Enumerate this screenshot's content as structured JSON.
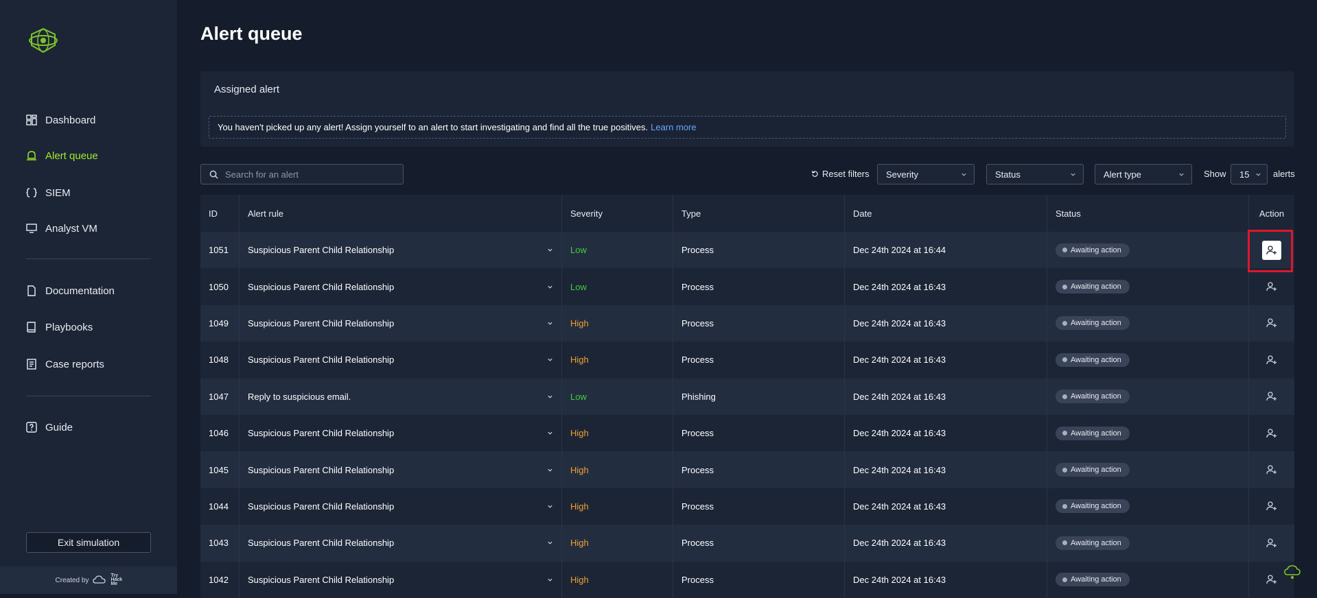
{
  "sidebar": {
    "nav_top": [
      {
        "label": "Dashboard",
        "icon": "dashboard-icon"
      },
      {
        "label": "Alert queue",
        "icon": "bell-icon",
        "active": true
      },
      {
        "label": "SIEM",
        "icon": "brackets-icon"
      },
      {
        "label": "Analyst VM",
        "icon": "monitor-icon"
      }
    ],
    "nav_mid": [
      {
        "label": "Documentation",
        "icon": "document-icon"
      },
      {
        "label": "Playbooks",
        "icon": "book-icon"
      },
      {
        "label": "Case reports",
        "icon": "report-icon"
      }
    ],
    "nav_bottom": [
      {
        "label": "Guide",
        "icon": "help-icon"
      }
    ],
    "exit_label": "Exit simulation",
    "created_by": "Created by",
    "brand_text": "Try Hack Me"
  },
  "page": {
    "title": "Alert queue",
    "assigned_title": "Assigned alert",
    "notice_text": "You haven't picked up any alert! Assign yourself to an alert to start investigating and find all the true positives.",
    "notice_link": "Learn more"
  },
  "filters": {
    "search_placeholder": "Search for an alert",
    "reset_label": "Reset filters",
    "severity_label": "Severity",
    "status_label": "Status",
    "alert_type_label": "Alert type",
    "show_label": "Show",
    "show_value": "15",
    "alerts_label": "alerts"
  },
  "table": {
    "headers": {
      "id": "ID",
      "rule": "Alert rule",
      "severity": "Severity",
      "type": "Type",
      "date": "Date",
      "status": "Status",
      "action": "Action"
    },
    "rows": [
      {
        "id": "1051",
        "rule": "Suspicious Parent Child Relationship",
        "severity": "Low",
        "type": "Process",
        "date": "Dec 24th 2024 at 16:44",
        "status": "Awaiting action"
      },
      {
        "id": "1050",
        "rule": "Suspicious Parent Child Relationship",
        "severity": "Low",
        "type": "Process",
        "date": "Dec 24th 2024 at 16:43",
        "status": "Awaiting action"
      },
      {
        "id": "1049",
        "rule": "Suspicious Parent Child Relationship",
        "severity": "High",
        "type": "Process",
        "date": "Dec 24th 2024 at 16:43",
        "status": "Awaiting action"
      },
      {
        "id": "1048",
        "rule": "Suspicious Parent Child Relationship",
        "severity": "High",
        "type": "Process",
        "date": "Dec 24th 2024 at 16:43",
        "status": "Awaiting action"
      },
      {
        "id": "1047",
        "rule": "Reply to suspicious email.",
        "severity": "Low",
        "type": "Phishing",
        "date": "Dec 24th 2024 at 16:43",
        "status": "Awaiting action"
      },
      {
        "id": "1046",
        "rule": "Suspicious Parent Child Relationship",
        "severity": "High",
        "type": "Process",
        "date": "Dec 24th 2024 at 16:43",
        "status": "Awaiting action"
      },
      {
        "id": "1045",
        "rule": "Suspicious Parent Child Relationship",
        "severity": "High",
        "type": "Process",
        "date": "Dec 24th 2024 at 16:43",
        "status": "Awaiting action"
      },
      {
        "id": "1044",
        "rule": "Suspicious Parent Child Relationship",
        "severity": "High",
        "type": "Process",
        "date": "Dec 24th 2024 at 16:43",
        "status": "Awaiting action"
      },
      {
        "id": "1043",
        "rule": "Suspicious Parent Child Relationship",
        "severity": "High",
        "type": "Process",
        "date": "Dec 24th 2024 at 16:43",
        "status": "Awaiting action"
      },
      {
        "id": "1042",
        "rule": "Suspicious Parent Child Relationship",
        "severity": "High",
        "type": "Process",
        "date": "Dec 24th 2024 at 16:43",
        "status": "Awaiting action"
      }
    ]
  },
  "colors": {
    "accent": "#a3ea2a",
    "severity_low": "#3fcf3f",
    "severity_high": "#f0a030",
    "link": "#6aa6ff",
    "highlight_box": "#e0162b"
  }
}
